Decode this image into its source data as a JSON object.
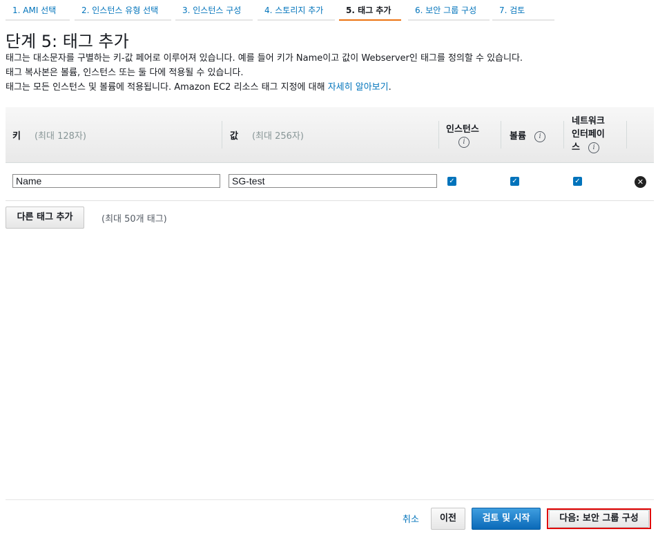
{
  "wizard": {
    "steps": [
      {
        "label": "1. AMI 선택"
      },
      {
        "label": "2. 인스턴스 유형 선택"
      },
      {
        "label": "3. 인스턴스 구성"
      },
      {
        "label": "4. 스토리지 추가"
      },
      {
        "label": "5. 태그 추가"
      },
      {
        "label": "6. 보안 그룹 구성"
      },
      {
        "label": "7. 검토"
      }
    ],
    "active_step": 4
  },
  "page": {
    "title": "단계 5: 태그 추가",
    "desc1": "태그는 대소문자를 구별하는 키-값 페어로 이루어져 있습니다. 예를 들어 키가 Name이고 값이 Webserver인 태그를 정의할 수 있습니다.",
    "desc2": "태그 복사본은 볼륨, 인스턴스 또는 둘 다에 적용될 수 있습니다.",
    "desc3": "태그는 모든 인스턴스 및 볼륨에 적용됩니다. Amazon EC2 리소스 태그 지정에 대해",
    "desc3_link": "자세히 알아보기",
    "desc3_end": "."
  },
  "table": {
    "key_header": "키",
    "key_hint": "(최대 128자)",
    "value_header": "값",
    "value_hint": "(최대 256자)",
    "instances_header": "인스턴스",
    "volumes_header": "볼륨",
    "network_header_line1": "네트워크",
    "network_header_line2": "인터페이",
    "network_header_line3": "스",
    "info_glyph": "i",
    "rows": [
      {
        "key": "Name",
        "value": "SG-test",
        "instances": true,
        "volumes": true,
        "network": true
      }
    ]
  },
  "actions": {
    "add_tag_label": "다른 태그 추가",
    "max_tags_note": "(최대 50개 태그)",
    "cancel_label": "취소",
    "previous_label": "이전",
    "review_launch_label": "검토 및 시작",
    "next_label": "다음: 보안 그룹 구성"
  },
  "icons": {
    "check": "check-icon",
    "remove": "remove-circle-icon",
    "info": "info-icon"
  },
  "colors": {
    "link": "#0073bb",
    "active_tab_border": "#ec7211",
    "primary_button": "#0a69b8",
    "highlight": "#e00000"
  }
}
